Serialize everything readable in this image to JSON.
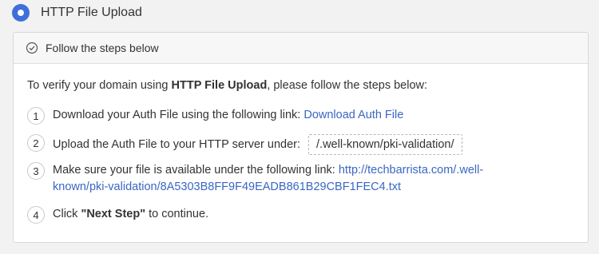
{
  "option": {
    "title": "HTTP File Upload",
    "selected": true
  },
  "panel": {
    "header": "Follow the steps below",
    "intro_pre": "To verify your domain using ",
    "intro_bold": "HTTP File Upload",
    "intro_post": ", please follow the steps below:",
    "steps": [
      {
        "number": "1",
        "text": "Download your Auth File using the following link: ",
        "link": "Download Auth File"
      },
      {
        "number": "2",
        "text": "Upload the Auth File to your HTTP server under:",
        "path": "/.well-known/pki-validation/"
      },
      {
        "number": "3",
        "text": "Make sure your file is available under the following link: ",
        "link_line1": "http://techbarrista.com/.well-",
        "link_line2": "known/pki-validation/8A5303B8FF9F49EADB861B29CBF1FEC4.txt"
      },
      {
        "number": "4",
        "text_pre": "Click ",
        "text_bold": "\"Next Step\"",
        "text_post": " to continue."
      }
    ]
  },
  "colors": {
    "accent": "#3f6fdb",
    "link": "#3a67c4"
  }
}
